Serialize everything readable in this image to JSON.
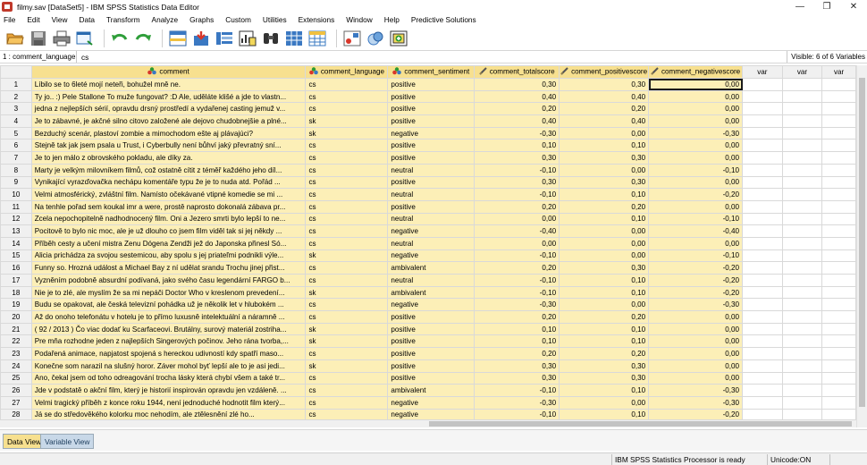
{
  "window": {
    "title": "filmy.sav [DataSet5] - IBM SPSS Statistics Data Editor",
    "controls": {
      "minimize": "—",
      "restore": "❐",
      "close": "✕"
    }
  },
  "menu": [
    "File",
    "Edit",
    "View",
    "Data",
    "Transform",
    "Analyze",
    "Graphs",
    "Custom",
    "Utilities",
    "Extensions",
    "Window",
    "Help",
    "Predictive Solutions"
  ],
  "toolbar_icons": [
    "open-folder-icon",
    "save-icon",
    "print-icon",
    "dialog-recall-icon",
    "undo-icon",
    "redo-icon",
    "goto-case-icon",
    "goto-variable-icon",
    "variables-icon",
    "run-descriptives-icon",
    "find-icon",
    "insert-cases-icon",
    "insert-variable-icon",
    "split-file-icon",
    "weight-cases-icon",
    "select-cases-icon",
    "value-labels-icon",
    "use-variable-sets-icon",
    "show-all-variables-icon"
  ],
  "cell_editor": {
    "reference": "1 : comment_language",
    "value": "cs",
    "visible": "Visible: 6 of 6 Variables"
  },
  "columns": {
    "comment": "comment",
    "comment_language": "comment_language",
    "comment_sentiment": "comment_sentiment",
    "comment_totalscore": "comment_totalscore",
    "comment_positivescore": "comment_positivescore",
    "comment_negativescore": "comment_negativescore",
    "var": "var"
  },
  "rows": [
    {
      "n": "1",
      "comment": "Líbilo se to 6leté mojí neteři, bohužel mně ne.",
      "lang": "cs",
      "sent": "positive",
      "total": "0,30",
      "pos": "0,30",
      "neg": "0,00"
    },
    {
      "n": "2",
      "comment": "Ty jo.. :) Pele Stallone To muže fungovat? :D Ale, uděláte klišé a jde to vlastn...",
      "lang": "cs",
      "sent": "positive",
      "total": "0,40",
      "pos": "0,40",
      "neg": "0,00"
    },
    {
      "n": "3",
      "comment": "jedna z nejlepších sérií, opravdu drsný prostředí a vydařenej casting jemuž v...",
      "lang": "cs",
      "sent": "positive",
      "total": "0,20",
      "pos": "0,20",
      "neg": "0,00"
    },
    {
      "n": "4",
      "comment": "Je to zábavné, je akčné silno citovo založené ale dejovo chudobnejšie a plné...",
      "lang": "sk",
      "sent": "positive",
      "total": "0,40",
      "pos": "0,40",
      "neg": "0,00"
    },
    {
      "n": "5",
      "comment": "Bezduchý scenár, plastoví zombie a mimochodom ešte aj plávajúci?",
      "lang": "sk",
      "sent": "negative",
      "total": "-0,30",
      "pos": "0,00",
      "neg": "-0,30"
    },
    {
      "n": "6",
      "comment": "Stejně tak jak jsem psala u Trust, i Cyberbully není bůhví jaký převratný sní...",
      "lang": "cs",
      "sent": "positive",
      "total": "0,10",
      "pos": "0,10",
      "neg": "0,00"
    },
    {
      "n": "7",
      "comment": "Je to jen málo z obrovského pokladu, ale díky za.",
      "lang": "cs",
      "sent": "positive",
      "total": "0,30",
      "pos": "0,30",
      "neg": "0,00"
    },
    {
      "n": "8",
      "comment": "Marty je velkým milovníkem filmů, což ostatně cítit z téměř každého jeho díl...",
      "lang": "cs",
      "sent": "neutral",
      "total": "-0,10",
      "pos": "0,00",
      "neg": "-0,10"
    },
    {
      "n": "9",
      "comment": "Vynikající vyrazďovačka nechápu komentáře typu že je to nuda atd. Pořád ...",
      "lang": "cs",
      "sent": "positive",
      "total": "0,30",
      "pos": "0,30",
      "neg": "0,00"
    },
    {
      "n": "10",
      "comment": "Velmi atmosférický, zvláštní film. Namísto očekávané vtipné komedie se mi ...",
      "lang": "cs",
      "sent": "neutral",
      "total": "-0,10",
      "pos": "0,10",
      "neg": "-0,20"
    },
    {
      "n": "11",
      "comment": "Na tenhle pořad sem koukal imr a were, prostě naprosto dokonalá zábava pr...",
      "lang": "cs",
      "sent": "positive",
      "total": "0,20",
      "pos": "0,20",
      "neg": "0,00"
    },
    {
      "n": "12",
      "comment": "Zcela nepochopitelně nadhodnocený film. Oni a Jezero smrti bylo lepší to ne...",
      "lang": "cs",
      "sent": "neutral",
      "total": "0,00",
      "pos": "0,10",
      "neg": "-0,10"
    },
    {
      "n": "13",
      "comment": "Pocitově to bylo nic moc, ale je už dlouho co jsem film viděl tak si jej někdy ...",
      "lang": "cs",
      "sent": "negative",
      "total": "-0,40",
      "pos": "0,00",
      "neg": "-0,40"
    },
    {
      "n": "14",
      "comment": "Příběh cesty a učení mistra Zenu Dógena Zendži jež do Japonska přinesl Só...",
      "lang": "cs",
      "sent": "neutral",
      "total": "0,00",
      "pos": "0,00",
      "neg": "0,00"
    },
    {
      "n": "15",
      "comment": "Alicia prichádza za svojou sestemicou, aby spolu s jej priateľmi podnikli výle...",
      "lang": "sk",
      "sent": "negative",
      "total": "-0,10",
      "pos": "0,00",
      "neg": "-0,10"
    },
    {
      "n": "16",
      "comment": "Funny so. Hrozná událost a Michael Bay z ní udělat srandu Trochu jinej přist...",
      "lang": "cs",
      "sent": "ambivalent",
      "total": "0,20",
      "pos": "0,30",
      "neg": "-0,20"
    },
    {
      "n": "17",
      "comment": "Vyzněním podobně absurdní podívaná, jako svého času legendární FARGO b...",
      "lang": "cs",
      "sent": "neutral",
      "total": "-0,10",
      "pos": "0,10",
      "neg": "-0,20"
    },
    {
      "n": "18",
      "comment": "Nie je to zlé, ale myslím že sa mi nepáči Doctor Who v kreslenom prevedení...",
      "lang": "sk",
      "sent": "ambivalent",
      "total": "-0,10",
      "pos": "0,10",
      "neg": "-0,20"
    },
    {
      "n": "19",
      "comment": "Budu se opakovat, ale česká televizní pohádka už je několik let v hlubokém ...",
      "lang": "cs",
      "sent": "negative",
      "total": "-0,30",
      "pos": "0,00",
      "neg": "-0,30"
    },
    {
      "n": "20",
      "comment": "Až do onoho telefonátu v hotelu je to přímo luxusně intelektuální a náramně ...",
      "lang": "cs",
      "sent": "positive",
      "total": "0,20",
      "pos": "0,20",
      "neg": "0,00"
    },
    {
      "n": "21",
      "comment": "( 92 / 2013 ) Čo viac dodať ku Scarfaceovi. Brutálny, surový materiál zostriha...",
      "lang": "sk",
      "sent": "positive",
      "total": "0,10",
      "pos": "0,10",
      "neg": "0,00"
    },
    {
      "n": "22",
      "comment": "Pre mňa rozhodne jeden z najlepších Singerových počinov. Jeho rána tvorba,...",
      "lang": "sk",
      "sent": "positive",
      "total": "0,10",
      "pos": "0,10",
      "neg": "0,00"
    },
    {
      "n": "23",
      "comment": "Podařená animace, napjatost spojená s hereckou udivností kdy spatří maso...",
      "lang": "cs",
      "sent": "positive",
      "total": "0,20",
      "pos": "0,20",
      "neg": "0,00"
    },
    {
      "n": "24",
      "comment": "Konečne som narazil na slušný horor. Záver mohol byť lepší ale to je asi jedi...",
      "lang": "sk",
      "sent": "positive",
      "total": "0,30",
      "pos": "0,30",
      "neg": "0,00"
    },
    {
      "n": "25",
      "comment": "Ano, čekal jsem od toho odreagování trocha lásky která chybí všem a také tr...",
      "lang": "cs",
      "sent": "positive",
      "total": "0,30",
      "pos": "0,30",
      "neg": "0,00"
    },
    {
      "n": "26",
      "comment": "Jde v podstatě o akční film, který je historií inspirován opravdu jen vzdáleně. ...",
      "lang": "cs",
      "sent": "ambivalent",
      "total": "-0,10",
      "pos": "0,10",
      "neg": "-0,30"
    },
    {
      "n": "27",
      "comment": "Velmi tragický příběh z konce roku 1944, není jednoduché hodnotit film který...",
      "lang": "cs",
      "sent": "negative",
      "total": "-0,30",
      "pos": "0,00",
      "neg": "-0,30"
    },
    {
      "n": "28",
      "comment": "Já se do středověkého kolorku moc nehodím, ale ztělesnění zlé ho...",
      "lang": "cs",
      "sent": "negative",
      "total": "-0,10",
      "pos": "0,10",
      "neg": "-0,20"
    }
  ],
  "tabs": {
    "data_view": "Data View",
    "variable_view": "Variable View"
  },
  "status": {
    "processor": "IBM SPSS Statistics Processor is ready",
    "unicode": "Unicode:ON"
  }
}
